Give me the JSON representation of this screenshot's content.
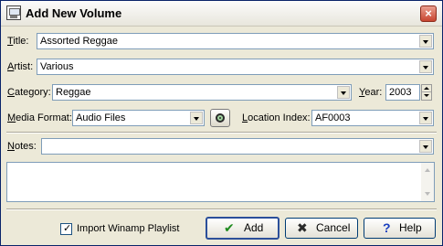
{
  "window": {
    "title": "Add New Volume",
    "app_icon": "film-icon",
    "close_icon": "close-icon"
  },
  "fields": {
    "title": {
      "label_prefix": "",
      "label_accel": "T",
      "label_rest": "itle:",
      "value": "Assorted Reggae"
    },
    "artist": {
      "label_accel": "A",
      "label_rest": "rtist:",
      "value": "Various"
    },
    "category": {
      "label_accel": "C",
      "label_rest": "ategory:",
      "value": "Reggae"
    },
    "year": {
      "label_accel": "Y",
      "label_rest": "ear:",
      "value": "2003"
    },
    "media_format": {
      "label_accel": "M",
      "label_rest": "edia Format:",
      "value": "Audio Files"
    },
    "location_index": {
      "label_accel": "L",
      "label_rest": "ocation Index:",
      "value": "AF0003"
    },
    "notes": {
      "label_accel": "N",
      "label_rest": "otes:",
      "value": "",
      "text": ""
    }
  },
  "footer": {
    "import_checkbox": {
      "label": "Import Winamp Playlist",
      "checked": true
    },
    "add_button": {
      "label": "Add",
      "icon": "checkmark-icon"
    },
    "cancel_button": {
      "label": "Cancel",
      "icon": "x-icon"
    },
    "help_button": {
      "label": "Help",
      "icon": "question-icon"
    }
  },
  "colors": {
    "window_bg": "#ece9d8",
    "input_border": "#7f9db9",
    "close_button": "#c84530",
    "add_icon": "#1e8a1e",
    "cancel_icon": "#2a2a2a",
    "help_icon": "#1a3fbf"
  }
}
